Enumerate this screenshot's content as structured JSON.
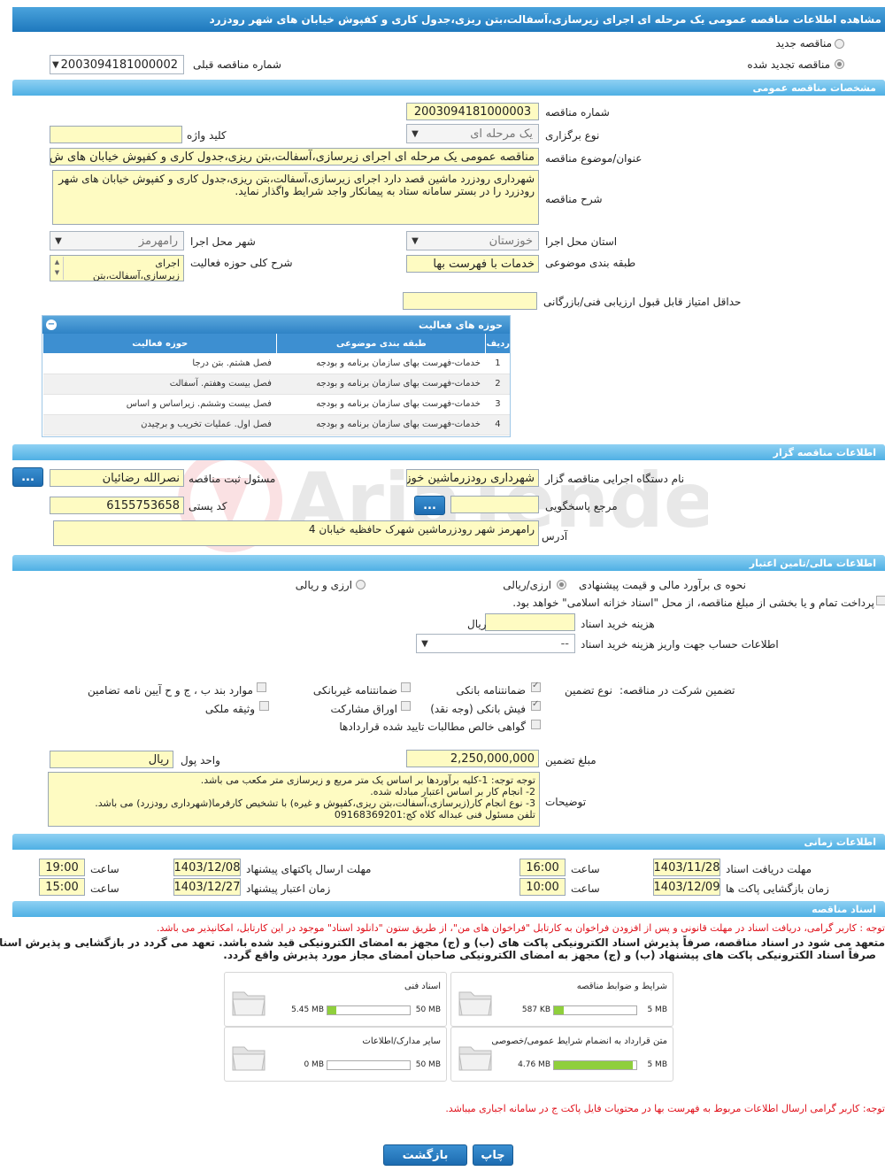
{
  "title": "مشاهده اطلاعات مناقصه عمومی یک مرحله ای اجرای زیرسازی،آسفالت،بتن ریزی،جدول کاری و کفپوش خیابان های شهر رودزرد",
  "top": {
    "new_tender": "مناقصه جدید",
    "renewed_tender": "مناقصه تجدید شده",
    "prev_number_label": "شماره مناقصه قبلی",
    "prev_number_value": "2003094181000002"
  },
  "general": {
    "header": "مشخصات مناقصه عمومی",
    "number_label": "شماره مناقصه",
    "number_value": "2003094181000003",
    "type_label": "نوع برگزاری",
    "type_value": "یک مرحله ای",
    "keyword_label": "کلید واژه",
    "keyword_value": "",
    "subject_label": "عنوان/موضوع مناقصه",
    "subject_value": "مناقصه عمومی یک مرحله ای  اجرای زیرسازی،آسفالت،بتن ریزی،جدول کاری و کفپوش خیابان های ش",
    "desc_label": "شرح مناقصه",
    "desc_value": "شهرداری رودزرد ماشین قصد دارد اجرای زیرسازی،آسفالت،بتن ریزی،جدول کاری و کفپوش خیابان های شهر رودزرد را در بستر سامانه ستاد به پیمانکار واجد شرایط واگذار نماید.",
    "province_label": "استان محل اجرا",
    "province_value": "خوزستان",
    "city_label": "شهر محل اجرا",
    "city_value": "رامهرمز",
    "category_label": "طبقه بندی موضوعی",
    "category_value": "خدمات با فهرست بها",
    "scope_label": "شرح کلی حوزه فعالیت",
    "scope_value": "اجرای زیرسازی،آسفالت،بتن",
    "min_score_label": "حداقل امتیاز قابل قبول ارزیابی فنی/بازرگانی",
    "min_score_value": ""
  },
  "activity": {
    "header": "حوزه های فعالیت",
    "columns": [
      "ردیف",
      "طبقه بندی موضوعی",
      "حوزه فعالیت"
    ],
    "rows": [
      [
        "1",
        "خدمات-فهرست بهای سازمان برنامه و بودجه",
        "فصل هشتم. بتن درجا"
      ],
      [
        "2",
        "خدمات-فهرست بهای سازمان برنامه و بودجه",
        "فصل بیست وهفتم. آسفالت"
      ],
      [
        "3",
        "خدمات-فهرست بهای سازمان برنامه و بودجه",
        "فصل بیست وششم. زیراساس و اساس"
      ],
      [
        "4",
        "خدمات-فهرست بهای سازمان برنامه و بودجه",
        "فصل اول. عملیات تخریب و برچیدن"
      ]
    ]
  },
  "organizer": {
    "header": "اطلاعات مناقصه گزار",
    "org_label": "نام دستگاه اجرایی مناقصه گزار",
    "org_value": "شهرداری رودزرماشین خوزستان",
    "responsible_label": "مسئول ثبت مناقصه",
    "responsible_value": "نصرالله رضائیان",
    "ref_label": "مرجع پاسخگویی",
    "ref_value": "",
    "postal_label": "کد پستی",
    "postal_value": "6155753658",
    "address_label": "آدرس",
    "address_value": "رامهرمز شهر رودزرماشین شهرک حافظیه خیابان 4",
    "dots": "..."
  },
  "finance": {
    "header": "اطلاعات مالی/تامین اعتبار",
    "method_label": "نحوه ی برآورد مالی و قیمت پیشنهادی",
    "opt_rial": "ارزی/ریالی",
    "opt_fx": "ارزی و ریالی",
    "treasury_text": "پرداخت تمام و یا بخشی از مبلغ مناقصه، از محل \"اسناد خزانه اسلامی\" خواهد بود.",
    "doc_fee_label": "هزینه خرید اسناد",
    "doc_fee_unit": "ریال",
    "doc_fee_value": "",
    "account_label": "اطلاعات حساب جهت واریز هزینه خرید اسناد",
    "account_value": "--"
  },
  "guarantee": {
    "section_label": "تضمین شرکت در مناقصه:",
    "type_label": "نوع تضمین",
    "items": {
      "bank_guarantee": "ضمانتنامه بانکی",
      "non_bank": "ضمانتنامه غیربانکی",
      "clauses": "موارد بند ب ، ج و ح آیین نامه تضامین",
      "bank_receipt": "فیش بانکی (وجه نقد)",
      "bonds": "اوراق مشارکت",
      "property": "وثیقه ملکی",
      "certificate": "گواهی خالص مطالبات تایید شده قراردادها"
    },
    "amount_label": "مبلغ تضمین",
    "amount_value": "2,250,000,000",
    "currency_label": "واحد پول",
    "currency_value": "ریال",
    "notes_label": "توضیحات",
    "notes_value": "توجه توجه: 1-کلیه برآوردها بر اساس یک متر مربع و زیرسازی متر مکعب می باشد.\n2- انجام کار بر اساس اعتبار مبادله شده.\n3- نوع انجام کار(زیرسازی،آسفالت،بتن ریزی،کفپوش و غیره) با تشخیص کارفرما(شهرداری رودزرد) می باشد.\nتلفن مسئول فنی عبداله کلاه کج:09168369201"
  },
  "timing": {
    "header": "اطلاعات زمانی",
    "doc_receive_label": "مهلت دریافت اسناد",
    "doc_receive_date": "1403/11/28",
    "doc_receive_time": "16:00",
    "send_label": "مهلت ارسال پاکتهای پیشنهاد",
    "send_date": "1403/12/08",
    "send_time": "19:00",
    "open_label": "زمان بازگشایی پاکت ها",
    "open_date": "1403/12/09",
    "open_time": "10:00",
    "validity_label": "زمان اعتبار پیشنهاد",
    "validity_date": "1403/12/27",
    "validity_time": "15:00",
    "time_label": "ساعت"
  },
  "docs": {
    "header": "اسناد مناقصه",
    "notice1": "توجه : کاربر گرامی، دریافت اسناد در مهلت قانونی و پس از افزودن فراخوان به کارتابل \"فراخوان های من\"، از طریق ستون \"دانلود اسناد\" موجود در این کارتابل، امکانپذیر می باشد.",
    "notice2a": "متعهد می شود در اسناد مناقصه، صرفاً پذیرش اسناد الکترونیکی پاکت های (ب) و (ج) مجهز به امضای الکترونیکی قید شده باشد. تعهد می گردد در بازگشایی و پذیرش اسناد،",
    "notice2b": "صرفاً اسناد الکترونیکی پاکت های پیشنهاد (ب) و (ج) مجهز به امضای الکترونیکی صاحبان امضای مجاز مورد پذیرش واقع گردد.",
    "files": [
      {
        "name": "شرایط و ضوابط مناقصه",
        "size": "587 KB",
        "max": "5 MB",
        "fill": 0.115
      },
      {
        "name": "اسناد فنی",
        "size": "5.45 MB",
        "max": "50 MB",
        "fill": 0.109
      },
      {
        "name": "متن قرارداد به انضمام شرایط عمومی/خصوصی",
        "size": "4.76 MB",
        "max": "5 MB",
        "fill": 0.952
      },
      {
        "name": "سایر مدارک/اطلاعات",
        "size": "0 MB",
        "max": "50 MB",
        "fill": 0
      }
    ],
    "notice3": "توجه: کاربر گرامی ارسال اطلاعات مربوط به فهرست بها در محتویات فایل پاکت ج در سامانه اجباری میباشد."
  },
  "actions": {
    "print": "چاپ",
    "back": "بازگشت"
  }
}
